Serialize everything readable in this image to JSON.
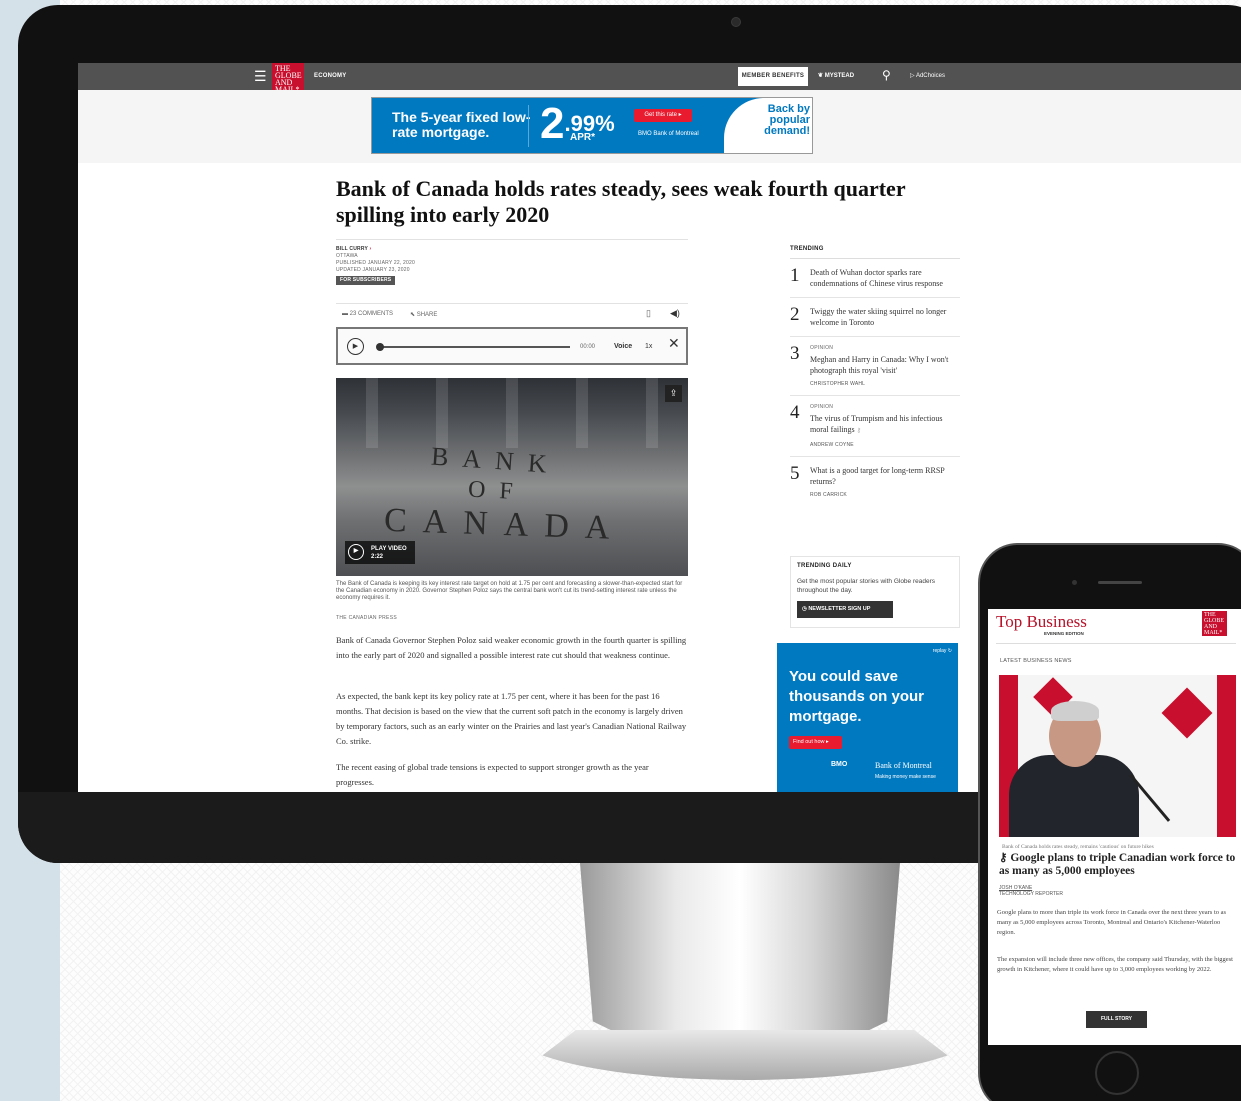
{
  "nav": {
    "section": "ECONOMY",
    "logo_lines": [
      "THE",
      "GLOBE",
      "AND",
      "MAIL*"
    ],
    "member_benefits": "MEMBER BENEFITS",
    "mystead": "MYSTEAD",
    "adchoices": "AdChoices"
  },
  "top_ad": {
    "headline": "The 5-year fixed low-rate mortgage.",
    "rate_big": "2",
    "rate_small": ".99%",
    "apr": "APR*",
    "cta": "Get this rate ▸",
    "bank": "BMO Bank of Montreal",
    "tagline": "Back by popular demand!"
  },
  "article": {
    "headline": "Bank of Canada holds rates steady, sees weak fourth quarter spilling into early 2020",
    "author": "BILL CURRY",
    "location": "OTTAWA",
    "published": "PUBLISHED JANUARY 22, 2020",
    "updated": "UPDATED JANUARY 23, 2020",
    "badge": "FOR SUBSCRIBERS",
    "comments": "23 COMMENTS",
    "share": "SHARE",
    "player_time": "00:00",
    "player_voice": "Voice",
    "player_speed": "1x",
    "photo_engraving": [
      "BANK",
      "OF",
      "CANADA"
    ],
    "play_video": "PLAY VIDEO",
    "video_length": "2:22",
    "caption": "The Bank of Canada is keeping its key interest rate target on hold at 1.75 per cent and forecasting a slower-than-expected start for the Canadian economy in 2020. Governor Stephen Poloz says the central bank won't cut its trend-setting interest rate unless the economy requires it.",
    "credit": "THE CANADIAN PRESS",
    "paragraphs": [
      "Bank of Canada Governor Stephen Poloz said weaker economic growth in the fourth quarter is spilling into the early part of 2020 and signalled a possible interest rate cut should that weakness continue.",
      "As expected, the bank kept its key policy rate at 1.75 per cent, where it has been for the past 16 months. That decision is based on the view that the current soft patch in the economy is largely driven by temporary factors, such as an early winter on the Prairies and last year's Canadian National Railway Co. strike.",
      "The recent easing of global trade tensions is expected to support stronger growth as the year progresses."
    ]
  },
  "trending": {
    "heading": "TRENDING",
    "items": [
      {
        "num": "1",
        "label": "",
        "title": "Death of Wuhan doctor sparks rare condemnations of Chinese virus response",
        "author": ""
      },
      {
        "num": "2",
        "label": "",
        "title": "Twiggy the water skiing squirrel no longer welcome in Toronto",
        "author": ""
      },
      {
        "num": "3",
        "label": "OPINION",
        "title": "Meghan and Harry in Canada: Why I won't photograph this royal 'visit'",
        "author": "CHRISTOPHER WAHL"
      },
      {
        "num": "4",
        "label": "OPINION",
        "title": "The virus of Trumpism and his infectious moral failings",
        "author": "ANDREW COYNE"
      },
      {
        "num": "5",
        "label": "",
        "title": "What is a good target for long-term RRSP returns?",
        "author": "ROB CARRICK"
      }
    ]
  },
  "trending_daily": {
    "heading": "TRENDING DAILY",
    "desc": "Get the most popular stories with Globe readers throughout the day.",
    "button": "NEWSLETTER SIGN UP"
  },
  "side_ad": {
    "replay": "replay",
    "headline": "You could save thousands on your mortgage.",
    "cta": "Find out how ▸",
    "bmo": "BMO",
    "bank": "Bank of Montreal",
    "tagline": "Making money make sense"
  },
  "phone": {
    "title": "Top Business",
    "edition": "EVENING EDITION",
    "latest": "LATEST BUSINESS NEWS",
    "photo_caption": "Bank of Canada holds rates steady, remains 'cautious' on future hikes",
    "headline": "Google plans to triple Canadian work force to as many as 5,000 employees",
    "author": "JOSH O'KANE",
    "role": "TECHNOLOGY REPORTER",
    "paragraphs": [
      "Google plans to more than triple its work force in Canada over the next three years to as many as 5,000 employees across Toronto, Montreal and Ontario's Kitchener-Waterloo region.",
      "The expansion will include three new offices, the company said Thursday, with the biggest growth in Kitchener, where it could have up to 3,000 employees working by 2022."
    ],
    "button": "FULL STORY"
  },
  "colors": {
    "brand_red": "#c8102e",
    "bmo_blue": "#0079c1",
    "nav_gray": "#525252"
  }
}
